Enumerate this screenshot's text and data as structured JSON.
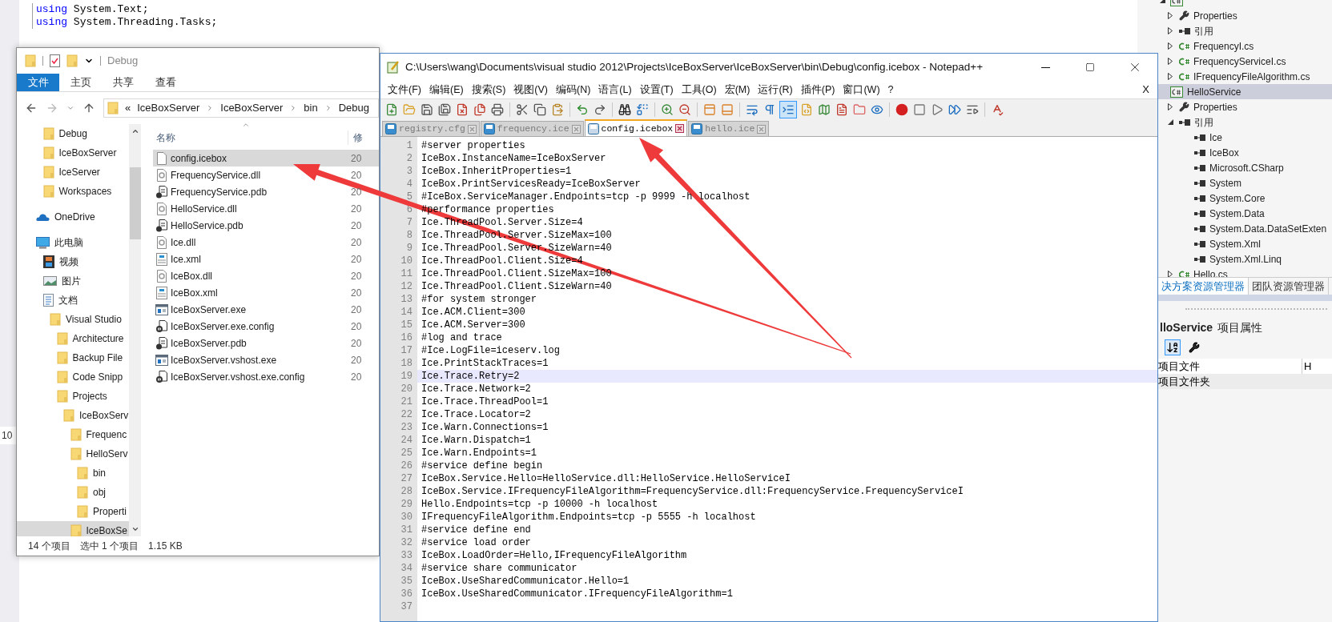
{
  "background_editor": {
    "code_lines": [
      {
        "keyword": "using",
        "text": "System.Text;"
      },
      {
        "keyword": "using",
        "text": "System.Threading.Tasks;"
      }
    ],
    "side_text": "10"
  },
  "solution_explorer": {
    "tree": [
      {
        "kind": "project",
        "expanded": true,
        "selected": false,
        "children": [
          {
            "label": "Properties",
            "kind": "properties",
            "expanded": false,
            "selected": false
          },
          {
            "label": "引用",
            "kind": "references",
            "expanded": false,
            "selected": false
          },
          {
            "label": "FrequencyI.cs",
            "kind": "cs",
            "expanded": false,
            "selected": false
          },
          {
            "label": "FrequencyServiceI.cs",
            "kind": "cs",
            "expanded": false,
            "selected": false
          },
          {
            "label": "IFrequencyFileAlgorithm.cs",
            "kind": "cs",
            "expanded": false,
            "selected": false
          }
        ]
      },
      {
        "label": "HelloService",
        "kind": "project",
        "selected": true,
        "children": [
          {
            "label": "Properties",
            "kind": "properties",
            "expanded": false,
            "selected": false
          },
          {
            "label": "引用",
            "kind": "references",
            "expanded": true,
            "selected": false,
            "children": [
              {
                "label": "Ice",
                "kind": "ref",
                "selected": false
              },
              {
                "label": "IceBox",
                "kind": "ref",
                "selected": false
              },
              {
                "label": "Microsoft.CSharp",
                "kind": "ref",
                "selected": false
              },
              {
                "label": "System",
                "kind": "ref",
                "selected": false
              },
              {
                "label": "System.Core",
                "kind": "ref",
                "selected": false
              },
              {
                "label": "System.Data",
                "kind": "ref",
                "selected": false
              },
              {
                "label": "System.Data.DataSetExten",
                "kind": "ref",
                "selected": false
              },
              {
                "label": "System.Xml",
                "kind": "ref",
                "selected": false
              },
              {
                "label": "System.Xml.Linq",
                "kind": "ref",
                "selected": false
              }
            ]
          },
          {
            "label": "Hello.cs",
            "kind": "cs",
            "expanded": false,
            "selected": false
          }
        ]
      }
    ],
    "tabs": [
      {
        "label": "决方案资源管理器",
        "selected": true
      },
      {
        "label": "团队资源管理器",
        "selected": false
      }
    ]
  },
  "properties": {
    "title": "lloService",
    "subtitle": "项目属性",
    "rows": [
      {
        "name": "项目文件",
        "value": "H"
      },
      {
        "name": "项目文件夹"
      }
    ]
  },
  "explorer": {
    "title": "Debug",
    "ribbon_tabs": [
      {
        "label": "文件",
        "selected": true
      },
      {
        "label": "主页",
        "selected": false
      },
      {
        "label": "共享",
        "selected": false
      },
      {
        "label": "查看",
        "selected": false
      }
    ],
    "address": {
      "overflow": "«",
      "crumbs": [
        "IceBoxServer",
        "IceBoxServer",
        "bin",
        "Debug"
      ]
    },
    "navigation": [
      {
        "items": [
          {
            "label": "Debug",
            "kind": "folder",
            "selected": false
          },
          {
            "label": "IceBoxServer",
            "kind": "folder",
            "selected": false
          },
          {
            "label": "IceServer",
            "kind": "folder",
            "selected": false
          },
          {
            "label": "Workspaces",
            "kind": "folder",
            "selected": false
          }
        ]
      },
      {
        "items": [
          {
            "label": "OneDrive",
            "kind": "cloud",
            "selected": false
          }
        ]
      },
      {
        "items": [
          {
            "label": "此电脑",
            "kind": "pc",
            "selected": false,
            "children": [
              {
                "label": "视频",
                "kind": "video",
                "selected": false
              },
              {
                "label": "图片",
                "kind": "picture",
                "selected": false
              },
              {
                "label": "文档",
                "kind": "doc",
                "selected": false,
                "children": [
                  {
                    "label": "Visual Studio",
                    "kind": "folder",
                    "selected": false,
                    "children": [
                      {
                        "label": "Architecture",
                        "kind": "folder",
                        "selected": false
                      },
                      {
                        "label": "Backup File",
                        "kind": "folder",
                        "selected": false
                      },
                      {
                        "label": "Code Snipp",
                        "kind": "folder",
                        "selected": false
                      },
                      {
                        "label": "Projects",
                        "kind": "folder",
                        "selected": false,
                        "children": [
                          {
                            "label": "IceBoxServ",
                            "kind": "folder",
                            "selected": false,
                            "children": [
                              {
                                "label": "Frequenc",
                                "kind": "folder",
                                "selected": false
                              },
                              {
                                "label": "HelloServ",
                                "kind": "folder",
                                "selected": false,
                                "children": [
                                  {
                                    "label": "bin",
                                    "kind": "folder",
                                    "selected": false
                                  },
                                  {
                                    "label": "obj",
                                    "kind": "folder",
                                    "selected": false
                                  },
                                  {
                                    "label": "Properti",
                                    "kind": "folder",
                                    "selected": false
                                  }
                                ]
                              },
                              {
                                "label": "IceBoxSe",
                                "kind": "folder",
                                "selected": true
                              }
                            ]
                          }
                        ]
                      }
                    ]
                  }
                ]
              }
            ]
          }
        ]
      }
    ],
    "columns": [
      "名称",
      "修"
    ],
    "files": [
      {
        "name": "config.icebox",
        "kind": "file",
        "date": "20",
        "selected": true
      },
      {
        "name": "FrequencyService.dll",
        "kind": "dll",
        "date": "20",
        "selected": false
      },
      {
        "name": "FrequencyService.pdb",
        "kind": "pdb",
        "date": "20",
        "selected": false
      },
      {
        "name": "HelloService.dll",
        "kind": "dll",
        "date": "20",
        "selected": false
      },
      {
        "name": "HelloService.pdb",
        "kind": "pdb",
        "date": "20",
        "selected": false
      },
      {
        "name": "Ice.dll",
        "kind": "dll",
        "date": "20",
        "selected": false
      },
      {
        "name": "Ice.xml",
        "kind": "xml",
        "date": "20",
        "selected": false
      },
      {
        "name": "IceBox.dll",
        "kind": "dll",
        "date": "20",
        "selected": false
      },
      {
        "name": "IceBox.xml",
        "kind": "xml",
        "date": "20",
        "selected": false
      },
      {
        "name": "IceBoxServer.exe",
        "kind": "exe",
        "date": "20",
        "selected": false
      },
      {
        "name": "IceBoxServer.exe.config",
        "kind": "config",
        "date": "20",
        "selected": false
      },
      {
        "name": "IceBoxServer.pdb",
        "kind": "pdb",
        "date": "20",
        "selected": false
      },
      {
        "name": "IceBoxServer.vshost.exe",
        "kind": "exe",
        "date": "20",
        "selected": false
      },
      {
        "name": "IceBoxServer.vshost.exe.config",
        "kind": "config",
        "date": "20",
        "selected": false
      }
    ],
    "status_bar": [
      "14 个项目",
      "选中 1 个项目",
      "1.15 KB"
    ]
  },
  "notepad": {
    "title": "C:\\Users\\wang\\Documents\\visual studio 2012\\Projects\\IceBoxServer\\IceBoxServer\\bin\\Debug\\config.icebox - Notepad++",
    "menu": [
      "文件(F)",
      "编辑(E)",
      "搜索(S)",
      "视图(V)",
      "编码(N)",
      "语言(L)",
      "设置(T)",
      "工具(O)",
      "宏(M)",
      "运行(R)",
      "插件(P)",
      "窗口(W)",
      "?"
    ],
    "close_doc": "X",
    "tabs": [
      {
        "label": "registry.cfg",
        "selected": false
      },
      {
        "label": "frequency.ice",
        "selected": false
      },
      {
        "label": "config.icebox",
        "selected": true
      },
      {
        "label": "hello.ice",
        "selected": false
      }
    ],
    "lines": [
      {
        "number": "1",
        "text": "#server properties",
        "current": false
      },
      {
        "number": "2",
        "text": "IceBox.InstanceName=IceBoxServer",
        "current": false
      },
      {
        "number": "3",
        "text": "IceBox.InheritProperties=1",
        "current": false
      },
      {
        "number": "4",
        "text": "IceBox.PrintServicesReady=IceBoxServer",
        "current": false
      },
      {
        "number": "5",
        "text": "#IceBox.ServiceManager.Endpoints=tcp -p 9999 -h localhost",
        "current": false
      },
      {
        "number": "6",
        "text": "#performance properties",
        "current": false
      },
      {
        "number": "7",
        "text": "Ice.ThreadPool.Server.Size=4",
        "current": false
      },
      {
        "number": "8",
        "text": "Ice.ThreadPool.Server.SizeMax=100",
        "current": false
      },
      {
        "number": "9",
        "text": "Ice.ThreadPool.Server.SizeWarn=40",
        "current": false
      },
      {
        "number": "10",
        "text": "Ice.ThreadPool.Client.Size=4",
        "current": false
      },
      {
        "number": "11",
        "text": "Ice.ThreadPool.Client.SizeMax=100",
        "current": false
      },
      {
        "number": "12",
        "text": "Ice.ThreadPool.Client.SizeWarn=40",
        "current": false
      },
      {
        "number": "13",
        "text": "#for system stronger",
        "current": false
      },
      {
        "number": "14",
        "text": "Ice.ACM.Client=300",
        "current": false
      },
      {
        "number": "15",
        "text": "Ice.ACM.Server=300",
        "current": false
      },
      {
        "number": "16",
        "text": "#log and trace",
        "current": false
      },
      {
        "number": "17",
        "text": "#Ice.LogFile=iceserv.log",
        "current": false
      },
      {
        "number": "18",
        "text": "Ice.PrintStackTraces=1",
        "current": false
      },
      {
        "number": "19",
        "text": "Ice.Trace.Retry=2",
        "current": true
      },
      {
        "number": "20",
        "text": "Ice.Trace.Network=2",
        "current": false
      },
      {
        "number": "21",
        "text": "Ice.Trace.ThreadPool=1",
        "current": false
      },
      {
        "number": "22",
        "text": "Ice.Trace.Locator=2",
        "current": false
      },
      {
        "number": "23",
        "text": "Ice.Warn.Connections=1",
        "current": false
      },
      {
        "number": "24",
        "text": "Ice.Warn.Dispatch=1",
        "current": false
      },
      {
        "number": "25",
        "text": "Ice.Warn.Endpoints=1",
        "current": false
      },
      {
        "number": "26",
        "text": "#service define begin",
        "current": false
      },
      {
        "number": "27",
        "text": "IceBox.Service.Hello=HelloService.dll:HelloService.HelloServiceI",
        "current": false
      },
      {
        "number": "28",
        "text": "IceBox.Service.IFrequencyFileAlgorithm=FrequencyService.dll:FrequencyService.FrequencyServiceI",
        "current": false
      },
      {
        "number": "29",
        "text": "Hello.Endpoints=tcp -p 10000 -h localhost",
        "current": false
      },
      {
        "number": "30",
        "text": "IFrequencyFileAlgorithm.Endpoints=tcp -p 5555 -h localhost",
        "current": false
      },
      {
        "number": "31",
        "text": "#service define end",
        "current": false
      },
      {
        "number": "32",
        "text": "#service load order",
        "current": false
      },
      {
        "number": "33",
        "text": "IceBox.LoadOrder=Hello,IFrequencyFileAlgorithm",
        "current": false
      },
      {
        "number": "34",
        "text": "#service share communicator",
        "current": false
      },
      {
        "number": "35",
        "text": "IceBox.UseSharedCommunicator.Hello=1",
        "current": false
      },
      {
        "number": "36",
        "text": "IceBox.UseSharedCommunicator.IFrequencyFileAlgorithm=1",
        "current": false
      },
      {
        "number": "37",
        "current": false
      }
    ]
  }
}
